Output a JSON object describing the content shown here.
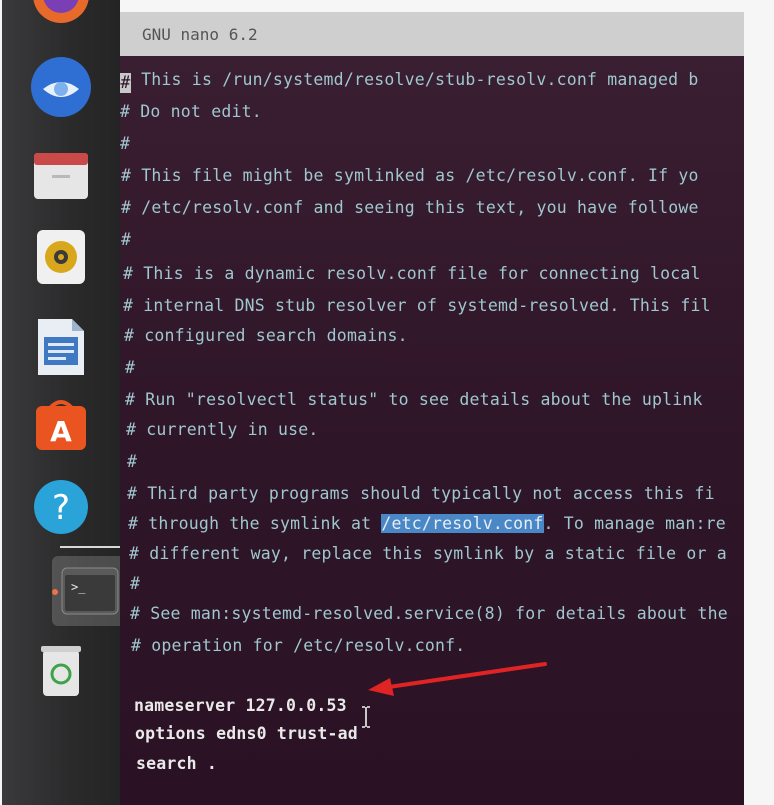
{
  "titlebar": {
    "title": "GNU nano 6.2"
  },
  "file_lines": [
    "This is /run/systemd/resolve/stub-resolv.conf managed b",
    "# Do not edit.",
    "#",
    "# This file might be symlinked as /etc/resolv.conf. If yo",
    "# /etc/resolv.conf and seeing this text, you have followe",
    "#",
    "# This is a dynamic resolv.conf file for connecting local",
    "# internal DNS stub resolver of systemd-resolved. This fil",
    "# configured search domains.",
    "#",
    "# Run \"resolvectl status\" to see details about the uplink",
    "# currently in use.",
    "#",
    "# Third party programs should typically not access this fi",
    "# through the symlink at ",
    "# different way, replace this symlink by a static file or a",
    "#",
    "# See man:systemd-resolved.service(8) for details about the",
    "# operation for /etc/resolv.conf."
  ],
  "cursor_char": "#",
  "highlight": {
    "selected_text": "/etc/resolv.conf",
    "after_text": ". To manage man:re"
  },
  "config_lines": [
    "nameserver 127.0.0.53",
    "options edns0 trust-ad",
    "search ."
  ],
  "dock": {
    "items": [
      "firefox-icon",
      "thunderbird-icon",
      "files-icon",
      "rhythmbox-icon",
      "libreoffice-writer-icon",
      "app-center-icon",
      "help-icon",
      "terminal-icon",
      "trash-icon"
    ]
  },
  "colors": {
    "terminal_bg": "#2f1528",
    "comment_text": "#9fc7cf",
    "selection": "#4a87c7",
    "arrow": "#e02424"
  }
}
